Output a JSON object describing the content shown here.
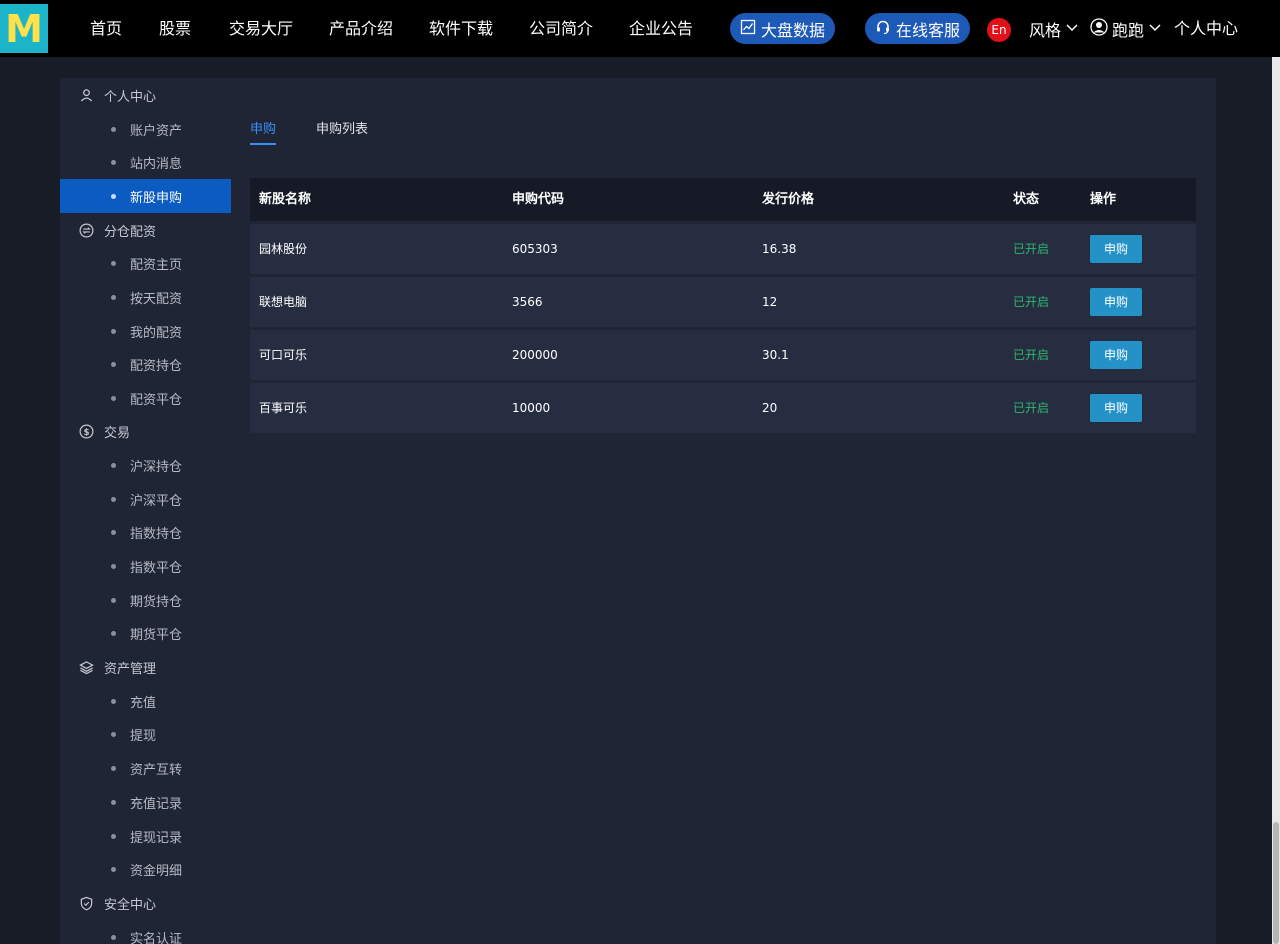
{
  "nav": {
    "logo_letter": "M",
    "items": [
      "首页",
      "股票",
      "交易大厅",
      "产品介绍",
      "软件下载",
      "公司简介",
      "企业公告"
    ],
    "market_data": "大盘数据",
    "online_service": "在线客服",
    "lang_badge": "En",
    "style_label": "风格",
    "user_name": "跑跑",
    "personal_center": "个人中心"
  },
  "sidebar": {
    "sections": [
      {
        "title": "个人中心",
        "icon": "user-icon",
        "items": [
          "账户资产",
          "站内消息",
          "新股申购"
        ]
      },
      {
        "title": "分仓配资",
        "icon": "exchange-icon",
        "items": [
          "配资主页",
          "按天配资",
          "我的配资",
          "配资持仓",
          "配资平仓"
        ]
      },
      {
        "title": "交易",
        "icon": "money-circle-icon",
        "items": [
          "沪深持仓",
          "沪深平仓",
          "指数持仓",
          "指数平仓",
          "期货持仓",
          "期货平仓"
        ]
      },
      {
        "title": "资产管理",
        "icon": "layers-icon",
        "items": [
          "充值",
          "提现",
          "资产互转",
          "充值记录",
          "提现记录",
          "资金明细"
        ]
      },
      {
        "title": "安全中心",
        "icon": "shield-icon",
        "items": [
          "实名认证"
        ]
      }
    ],
    "active_item": "新股申购"
  },
  "tabs": [
    "申购",
    "申购列表"
  ],
  "table": {
    "headers": [
      "新股名称",
      "申购代码",
      "发行价格",
      "状态",
      "操作"
    ],
    "rows": [
      {
        "name": "园林股份",
        "code": "605303",
        "price": "16.38",
        "status": "已开启",
        "action": "申购"
      },
      {
        "name": "联想电脑",
        "code": "3566",
        "price": "12",
        "status": "已开启",
        "action": "申购"
      },
      {
        "name": "可口可乐",
        "code": "200000",
        "price": "30.1",
        "status": "已开启",
        "action": "申购"
      },
      {
        "name": "百事可乐",
        "code": "10000",
        "price": "20",
        "status": "已开启",
        "action": "申购"
      }
    ]
  },
  "colors": {
    "topbar": "#000000",
    "page_bg": "#181c27",
    "panel_bg": "#202536",
    "active_blue": "#0b5bc2",
    "tab_accent": "#3a8ef6",
    "status_green": "#2fb46e",
    "action_button": "#2592c7",
    "pill_blue": "#1d5ab7",
    "lang_red": "#e3101a"
  }
}
